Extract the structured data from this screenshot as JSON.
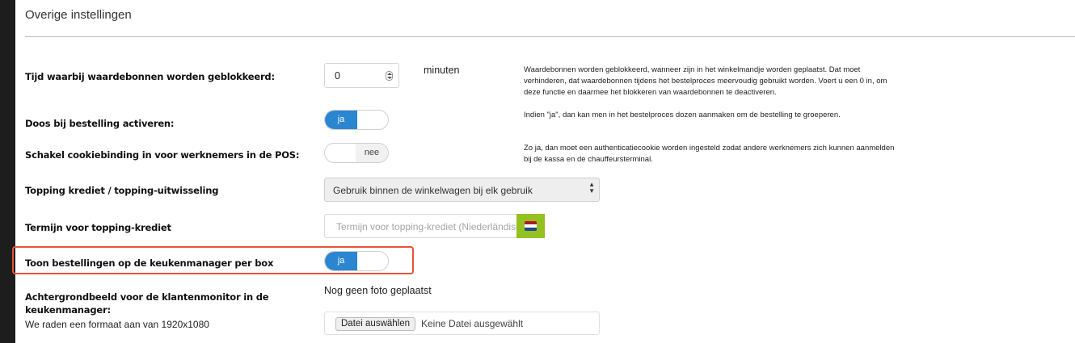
{
  "section": {
    "title": "Overige instellingen"
  },
  "fields": {
    "block_time": {
      "label": "Tijd waarbij waardebonnen worden geblokkeerd:",
      "value": "0",
      "unit": "minuten",
      "help": "Waardebonnen worden geblokkeerd, wanneer zijn in het winkelmandje worden geplaatst. Dat moet verhinderen, dat waardebonnen tijdens het bestelproces meervoudig gebruikt worden. Voert u een 0 in, om deze functie en daarmee het blokkeren van waardebonnen te deactiveren."
    },
    "box_order": {
      "label": "Doos bij bestelling activeren:",
      "toggle_label": "ja",
      "state": "on",
      "help": "Indien \"ja\", dan kan men in het bestelproces dozen aanmaken om de bestelling te groeperen."
    },
    "cookie_binding": {
      "label": "Schakel cookiebinding in voor werknemers in de POS:",
      "toggle_label": "nee",
      "state": "off",
      "help": "Zo ja, dan moet een authenticatiecookie worden ingesteld zodat andere werknemers zich kunnen aanmelden bij de kassa en de chauffeursterminal."
    },
    "topping_credit": {
      "label": "Topping krediet / topping-uitwisseling",
      "selected": "Gebruik binnen de winkelwagen bij elk gebruik"
    },
    "topping_term": {
      "label": "Termijn voor topping-krediet",
      "placeholder": "Termijn voor topping-krediet (Niederländisch)",
      "flag_icon": "flag-nl-icon"
    },
    "kitchen_box": {
      "label": "Toon bestellingen op de keukenmanager per box",
      "toggle_label": "ja",
      "state": "on",
      "highlight_color": "#e8533a"
    },
    "background_image": {
      "label_line1": "Achtergrondbeeld voor de klantenmonitor in de",
      "label_line2": "keukenmanager:",
      "sublabel": "We raden een formaat aan van 1920x1080",
      "status": "Nog geen foto geplaatst",
      "file_button": "Datei auswählen",
      "file_status": "Keine Datei ausgewählt"
    }
  },
  "colors": {
    "toggle_on": "#2a86d0",
    "flag_button": "#94c11f"
  }
}
